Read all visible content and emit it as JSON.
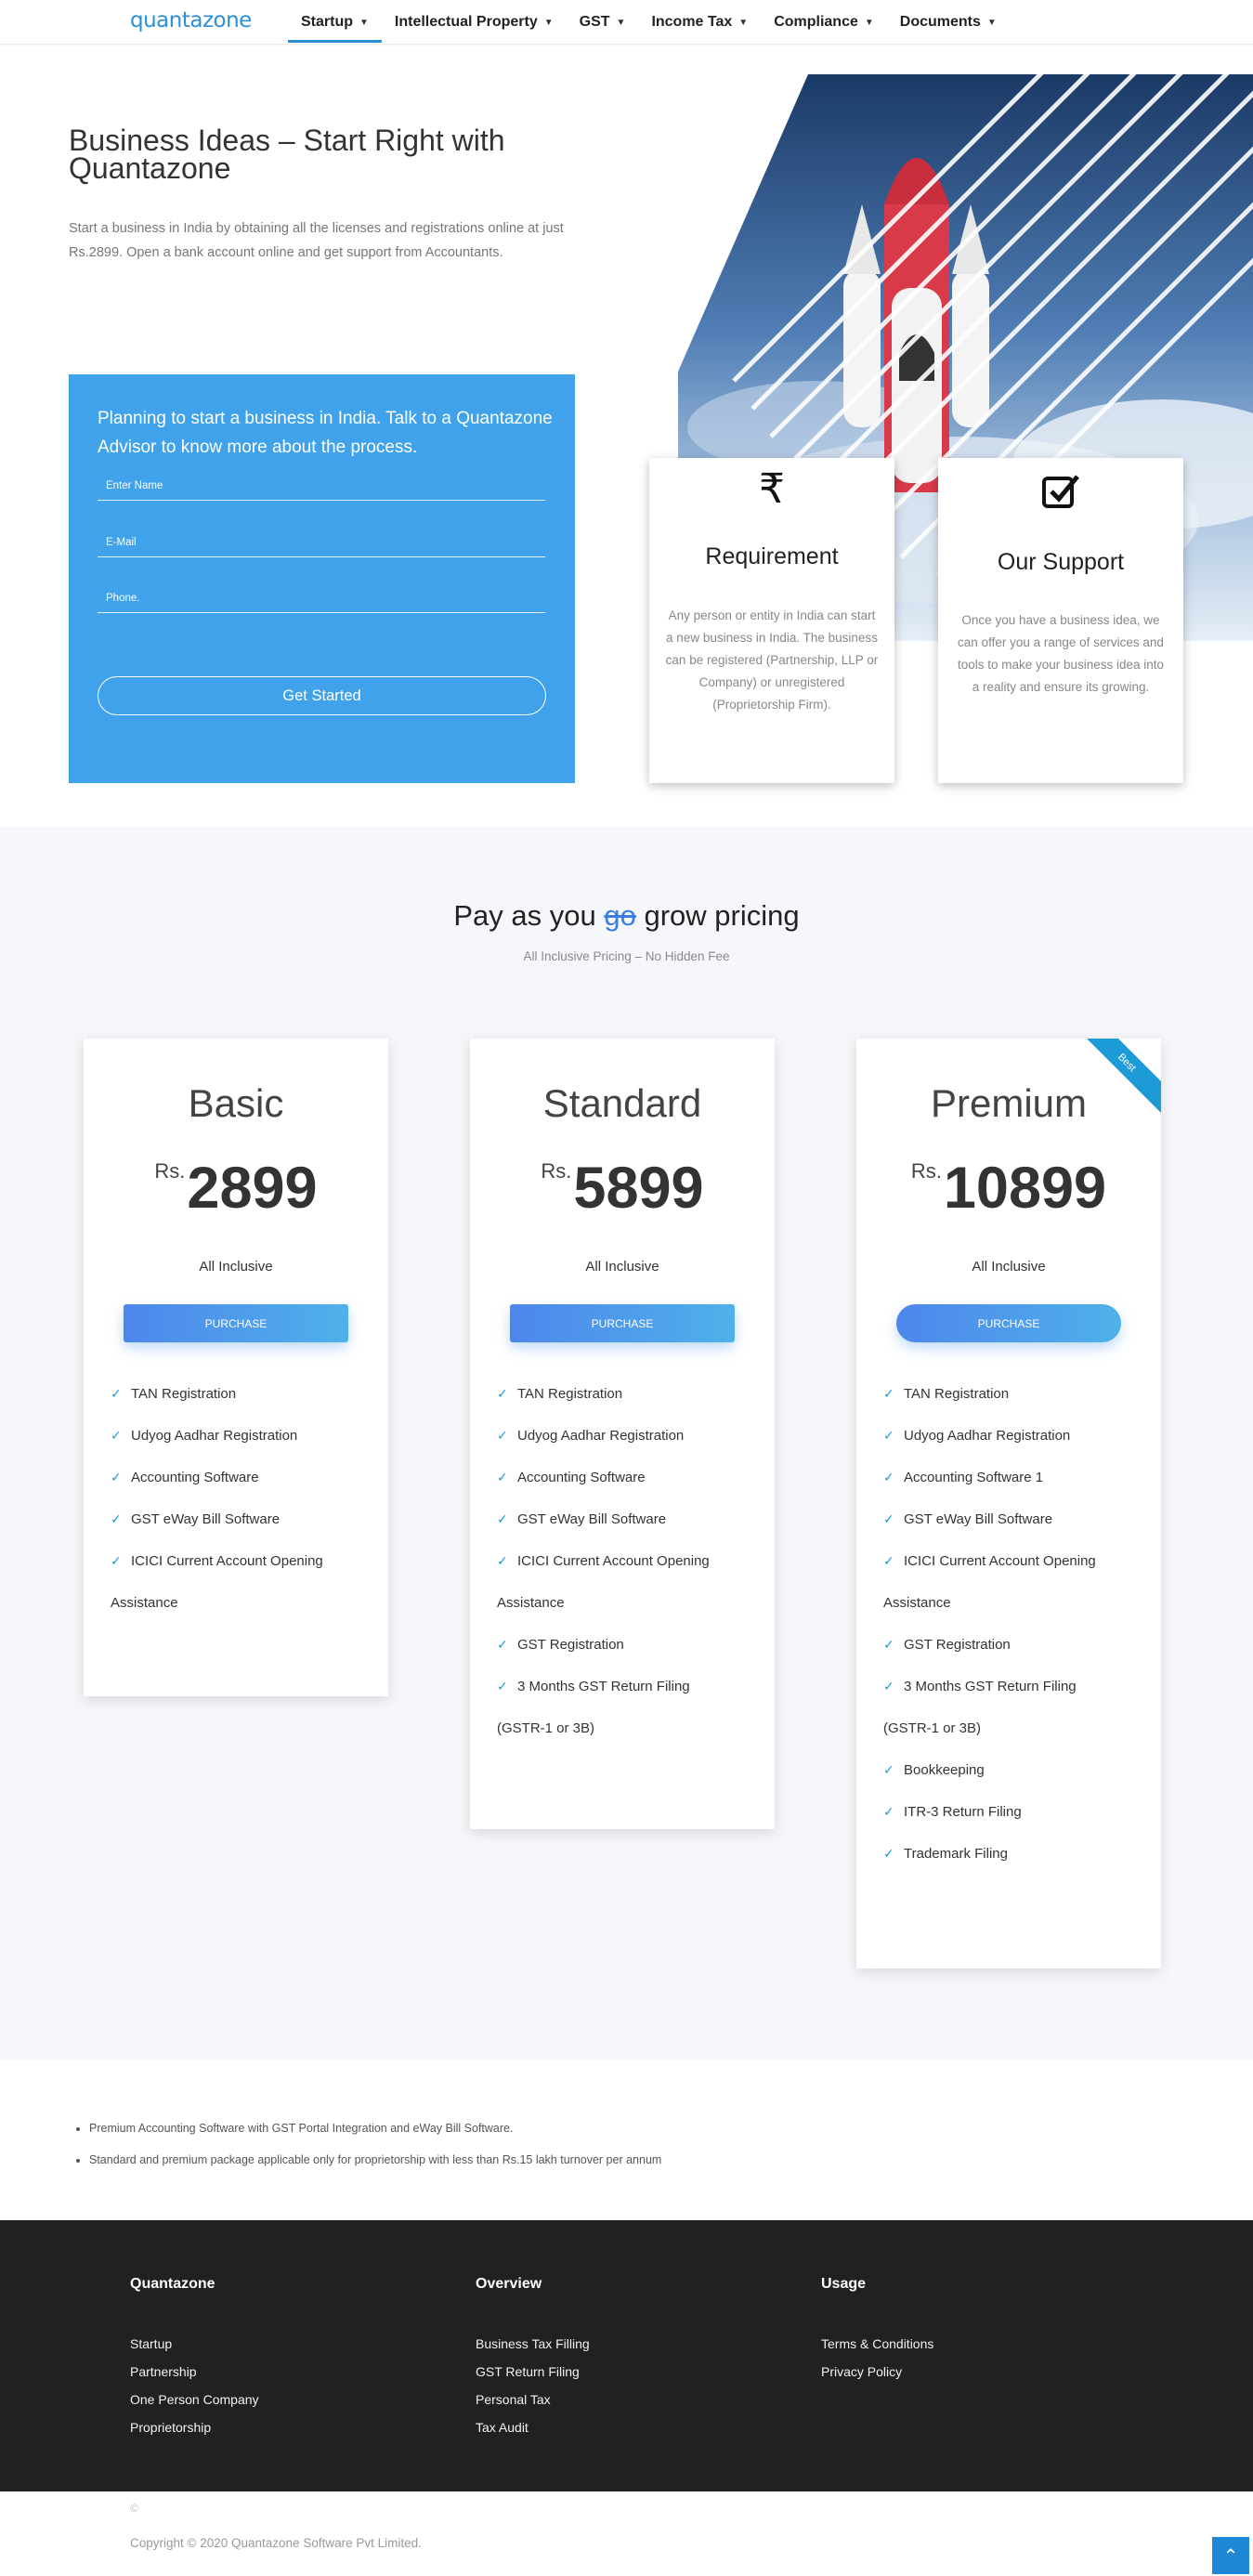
{
  "nav": {
    "logo": "quantazone",
    "items": [
      {
        "label": "Startup",
        "active": true
      },
      {
        "label": "Intellectual Property"
      },
      {
        "label": "GST"
      },
      {
        "label": "Income Tax"
      },
      {
        "label": "Compliance"
      },
      {
        "label": "Documents"
      }
    ]
  },
  "hero": {
    "title": "Business Ideas – Start Right with Quantazone",
    "description": "Start a business in India by obtaining all the licenses and registrations online at just Rs.2899. Open a bank account online and get support from Accountants."
  },
  "form": {
    "title": "Planning to start a business in India. Talk to a Quantazone Advisor to know more about the process.",
    "name_placeholder": "Enter Name",
    "email_placeholder": "E-Mail",
    "phone_placeholder": "Phone.",
    "submit_label": "Get Started"
  },
  "cards": [
    {
      "icon": "rupee-icon",
      "title": "Requirement",
      "text": "Any person or entity in India can start a new business in India. The business can be registered (Partnership, LLP or Company) or unregistered (Proprietorship Firm)."
    },
    {
      "icon": "checkbox-icon",
      "title": "Our Support",
      "text": "Once you have a business idea, we can offer you a range of services and tools to make your business idea into a reality and ensure its growing."
    }
  ],
  "pricing": {
    "heading_before": "Pay as you",
    "heading_strike": "go",
    "heading_after": "grow pricing",
    "subtitle": "All Inclusive Pricing – No Hidden Fee",
    "currency": "Rs.",
    "plans": [
      {
        "name": "Basic",
        "price": "2899",
        "inclusive": "All Inclusive",
        "button": "PURCHASE",
        "features": [
          "TAN Registration",
          "Udyog Aadhar Registration",
          "Accounting Software",
          "GST eWay Bill Software"
        ],
        "wrap_feature": {
          "first": "ICICI Current Account Opening",
          "rest": "Assistance"
        }
      },
      {
        "name": "Standard",
        "price": "5899",
        "inclusive": "All Inclusive",
        "button": "PURCHASE",
        "features": [
          "TAN Registration",
          "Udyog Aadhar Registration",
          "Accounting Software",
          "GST eWay Bill Software"
        ],
        "wrap_feature": {
          "first": "ICICI Current Account Opening",
          "rest": "Assistance"
        },
        "features_after": [
          "GST Registration"
        ],
        "wrap_feature_2": {
          "first": "3 Months GST Return Filing",
          "rest": "(GSTR-1 or 3B)"
        }
      },
      {
        "name": "Premium",
        "price": "10899",
        "inclusive": "All Inclusive",
        "button": "PURCHASE",
        "ribbon": "Best",
        "features": [
          "TAN Registration",
          "Udyog Aadhar Registration",
          "Accounting Software 1",
          "GST eWay Bill Software"
        ],
        "wrap_feature": {
          "first": "ICICI Current Account Opening",
          "rest": "Assistance"
        },
        "features_after": [
          "GST Registration"
        ],
        "wrap_feature_2": {
          "first": "3 Months GST Return Filing",
          "rest": "(GSTR-1 or 3B)"
        },
        "features_tail": [
          "Bookkeeping",
          "ITR-3 Return Filing",
          "Trademark Filing"
        ]
      }
    ]
  },
  "notes": [
    "Premium Accounting Software with GST Portal Integration and eWay Bill Software.",
    "Standard and premium package applicable only for proprietorship with less than Rs.15 lakh turnover per annum"
  ],
  "footer": {
    "columns": [
      {
        "title": "Quantazone",
        "links": [
          "Startup",
          "Partnership",
          "One Person Company",
          "Proprietorship"
        ]
      },
      {
        "title": "Overview",
        "links": [
          "Business Tax Filling",
          "GST Return Filing",
          "Personal Tax",
          "Tax Audit"
        ]
      },
      {
        "title": "Usage",
        "links": [
          "Terms & Conditions",
          "Privacy Policy"
        ]
      }
    ],
    "copy_symbol": "©",
    "copyright": "Copyright © 2020 Quantazone Software Pvt Limited."
  },
  "colors": {
    "accent": "#2d8fd7",
    "form_bg": "#3fa2ea",
    "footer_bg": "#212121",
    "pricing_bg": "#f6f7fa"
  }
}
